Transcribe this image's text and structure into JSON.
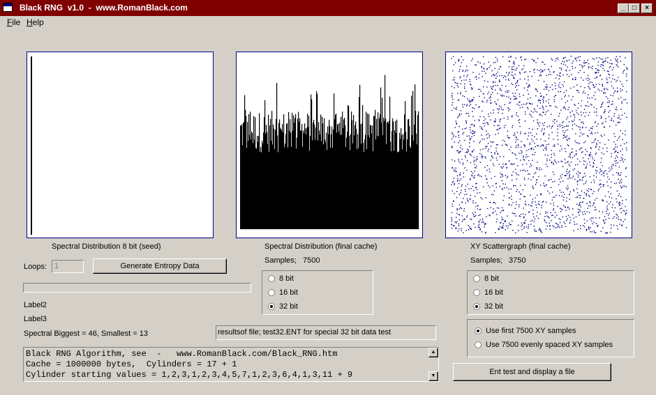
{
  "window": {
    "title": "Black RNG  v1.0  -  www.RomanBlack.com"
  },
  "menu": {
    "items": [
      "File",
      "Help"
    ]
  },
  "panels": {
    "seed_label": "Spectral Distribution 8 bit (seed)",
    "cache_label": "Spectral Distribution (final cache)",
    "scatter_label": "XY Scattergraph (final cache)"
  },
  "loops": {
    "label": "Loops:",
    "value": "1"
  },
  "generate_button": "Generate Entropy Data",
  "samples_cache": {
    "label": "Samples;",
    "value": "7500"
  },
  "samples_scatter": {
    "label": "Samples;",
    "value": "3750"
  },
  "bits_cache": [
    {
      "label": "8 bit",
      "selected": false
    },
    {
      "label": "16 bit",
      "selected": false
    },
    {
      "label": "32 bit",
      "selected": true
    }
  ],
  "bits_scatter": [
    {
      "label": "8 bit",
      "selected": false
    },
    {
      "label": "16 bit",
      "selected": false
    },
    {
      "label": "32 bit",
      "selected": true
    }
  ],
  "sample_mode": [
    {
      "label": "Use first 7500 XY samples",
      "selected": true
    },
    {
      "label": "Use 7500 evenly spaced XY samples",
      "selected": false
    }
  ],
  "label2": "Label2",
  "label3": "Label3",
  "spectral_stats": "Spectral Biggest = 46, Smallest = 13",
  "results_field": "resultsof file; test32.ENT for special 32 bit data test",
  "memo_lines": [
    "Black RNG Algorithm, see  -   www.RomanBlack.com/Black_RNG.htm",
    "Cache = 1000000 bytes,  Cylinders = 17 + 1",
    "Cylinder starting values = 1,2,3,1,2,3,4,5,7,1,2,3,6,4,1,3,11 + 9"
  ],
  "ent_button": "Ent test and display a file",
  "colors": {
    "titlebar": "#800000",
    "face": "#d4d0c8",
    "scatter_dot": "#000080"
  },
  "icons": {
    "minimize": "minimize-icon",
    "maximize": "maximize-icon",
    "close": "close-icon"
  }
}
